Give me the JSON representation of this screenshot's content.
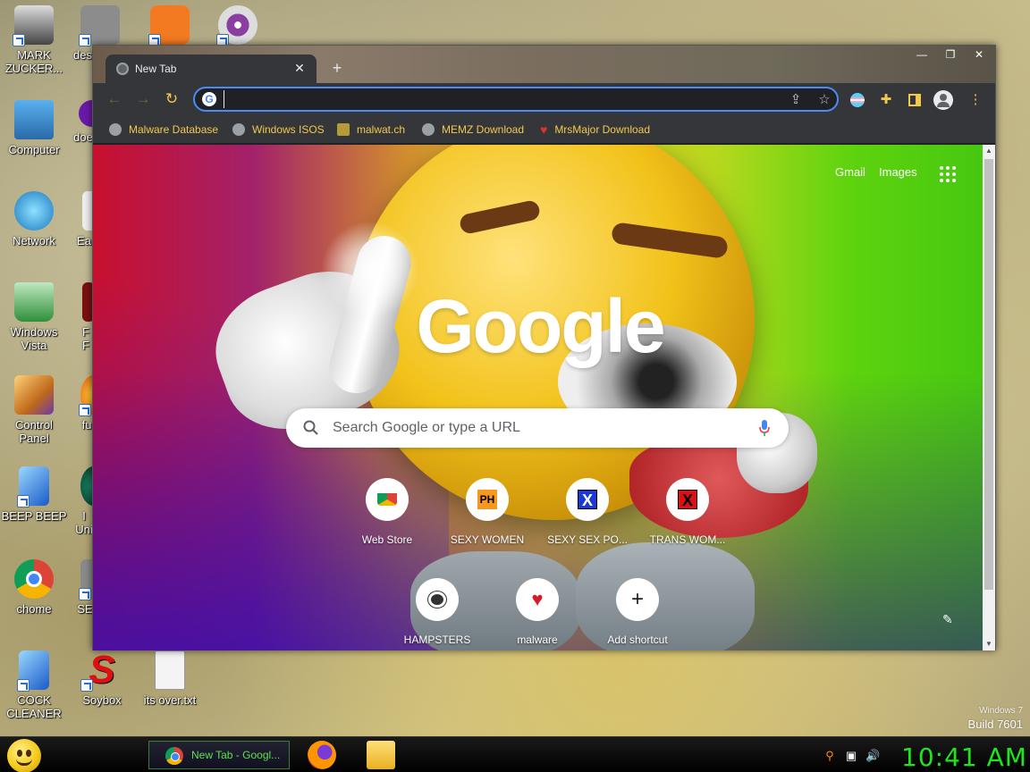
{
  "desktop": {
    "icons": [
      {
        "label": "MARK ZUCKER...",
        "icon": "mark-zuckerberg-shortcut-icon"
      },
      {
        "label": "des",
        "icon": "desktop-shortcut-icon"
      },
      {
        "label": "Computer",
        "icon": "computer-icon"
      },
      {
        "label": "doe",
        "icon": "doe-shortcut-icon"
      },
      {
        "label": "Network",
        "icon": "network-icon"
      },
      {
        "label": "Ea",
        "icon": "ea-shortcut-icon"
      },
      {
        "label": "Windows Vista",
        "icon": "recycle-bin-icon"
      },
      {
        "label": "F F",
        "icon": "f-shortcut-icon"
      },
      {
        "label": "Control Panel",
        "icon": "control-panel-icon"
      },
      {
        "label": "fu",
        "icon": "fu-shortcut-icon"
      },
      {
        "label": "BEEP BEEP",
        "icon": "beep-beep-icon"
      },
      {
        "label": "I Uni",
        "icon": "uni-shortcut-icon"
      },
      {
        "label": "chome",
        "icon": "chrome-icon"
      },
      {
        "label": "SE",
        "icon": "se-shortcut-icon"
      },
      {
        "label": "COCK CLEANER",
        "icon": "cleaner-icon"
      },
      {
        "label": "Soybox",
        "icon": "soybox-icon"
      },
      {
        "label": "its over.txt",
        "icon": "text-file-icon"
      }
    ]
  },
  "browser": {
    "tab": {
      "title": "New Tab",
      "close": "✕"
    },
    "new_tab": "+",
    "window_controls": {
      "minimize": "—",
      "maximize": "❐",
      "close": "✕"
    },
    "omnibox": {
      "value": "",
      "placeholder": ""
    },
    "bookmarks": [
      {
        "label": "Malware Database",
        "icon": "globe-icon"
      },
      {
        "label": "Windows ISOS",
        "icon": "globe-icon"
      },
      {
        "label": "malwat.ch",
        "icon": "malwatch-icon"
      },
      {
        "label": "MEMZ Download",
        "icon": "globe-icon"
      },
      {
        "label": "MrsMajor Download",
        "icon": "heart-icon"
      }
    ],
    "ntp": {
      "gmail": "Gmail",
      "images": "Images",
      "logo": "Google",
      "search_placeholder": "Search Google or type a URL",
      "shortcuts": [
        {
          "label": "Web Store",
          "glyph": ""
        },
        {
          "label": "SEXY WOMEN",
          "glyph": "PH"
        },
        {
          "label": "SEXY SEX PO...",
          "glyph": "X"
        },
        {
          "label": "TRANS WOM...",
          "glyph": "X"
        },
        {
          "label": "HAMPSTERS",
          "glyph": ""
        },
        {
          "label": "malware",
          "glyph": "♥"
        },
        {
          "label": "Add shortcut",
          "glyph": "+"
        }
      ]
    }
  },
  "watermark": {
    "line1": "Windows 7",
    "line2": "Build 7601"
  },
  "taskbar": {
    "active_task": "New Tab - Googl...",
    "clock": "10:41 AM"
  },
  "colors": {
    "bookmark_text": "#f2c94c",
    "clock": "#1ee61e",
    "omnibox_focus": "#4a8cf7"
  }
}
